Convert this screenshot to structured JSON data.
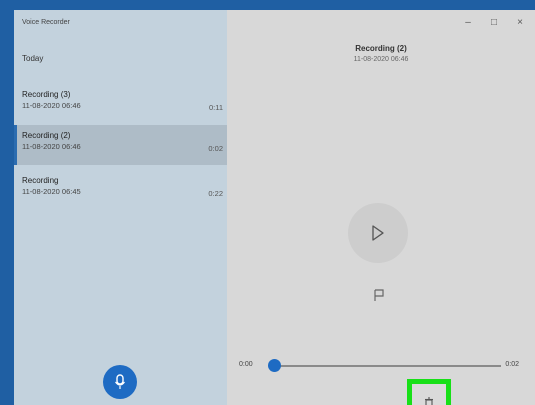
{
  "window": {
    "app_title": "Voice Recorder",
    "controls": {
      "minimize": "–",
      "maximize": "□",
      "close": "×"
    }
  },
  "sidebar": {
    "section_label": "Today",
    "recordings": [
      {
        "name": "Recording (3)",
        "date": "11-08-2020 06:46",
        "duration": "0:11",
        "selected": false
      },
      {
        "name": "Recording (2)",
        "date": "11-08-2020 06:46",
        "duration": "0:02",
        "selected": true
      },
      {
        "name": "Recording",
        "date": "11-08-2020 06:45",
        "duration": "0:22",
        "selected": false
      }
    ]
  },
  "player": {
    "title": "Recording (2)",
    "date": "11-08-2020 06:46",
    "time_current": "0:00",
    "time_total": "0:02",
    "progress": 0.0
  },
  "icons": {
    "mic": "microphone-icon",
    "play": "play-icon",
    "flag": "flag-icon",
    "share": "share-icon",
    "trim": "trim-icon",
    "delete": "delete-icon",
    "rename": "rename-icon",
    "more": "more-icon"
  },
  "colors": {
    "accent": "#1e6bc3",
    "highlight_box": "#18e018",
    "sidebar_bg": "#c3d2dd",
    "main_bg": "#d8d8d8"
  }
}
